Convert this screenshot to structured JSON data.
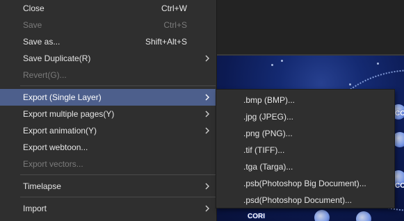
{
  "menu": {
    "items": [
      {
        "label": "Close",
        "shortcut": "Ctrl+W",
        "disabled": false
      },
      {
        "label": "Save",
        "shortcut": "Ctrl+S",
        "disabled": true
      },
      {
        "label": "Save as...",
        "shortcut": "Shift+Alt+S",
        "disabled": false
      },
      {
        "label": "Save Duplicate(R)",
        "shortcut": "",
        "disabled": false
      },
      {
        "label": "Revert(G)...",
        "shortcut": "",
        "disabled": true
      },
      {
        "label": "Export (Single Layer)",
        "shortcut": "",
        "disabled": false,
        "highlighted": true
      },
      {
        "label": "Export multiple pages(Y)",
        "shortcut": "",
        "disabled": false
      },
      {
        "label": "Export animation(Y)",
        "shortcut": "",
        "disabled": false
      },
      {
        "label": "Export webtoon...",
        "shortcut": "",
        "disabled": false
      },
      {
        "label": "Export vectors...",
        "shortcut": "",
        "disabled": true
      },
      {
        "label": "Timelapse",
        "shortcut": "",
        "disabled": false
      },
      {
        "label": "Import",
        "shortcut": "",
        "disabled": false
      }
    ]
  },
  "submenu": {
    "items": [
      {
        "label": ".bmp (BMP)..."
      },
      {
        "label": ".jpg (JPEG)..."
      },
      {
        "label": ".png (PNG)..."
      },
      {
        "label": ".tif (TIFF)..."
      },
      {
        "label": ".tga (Targa)..."
      },
      {
        "label": ".psb(Photoshop Big Document)..."
      },
      {
        "label": ".psd(Photoshop Document)..."
      }
    ]
  },
  "canvas": {
    "texts": [
      "CORI",
      "CORI",
      "CORI"
    ]
  },
  "colors": {
    "menu_bg": "#2f2f2f",
    "highlight": "#4d5f8c",
    "text": "#e6e6e6",
    "disabled_text": "#7b7b7b"
  },
  "icons": {
    "submenu_arrow": "chevron-right-icon"
  }
}
